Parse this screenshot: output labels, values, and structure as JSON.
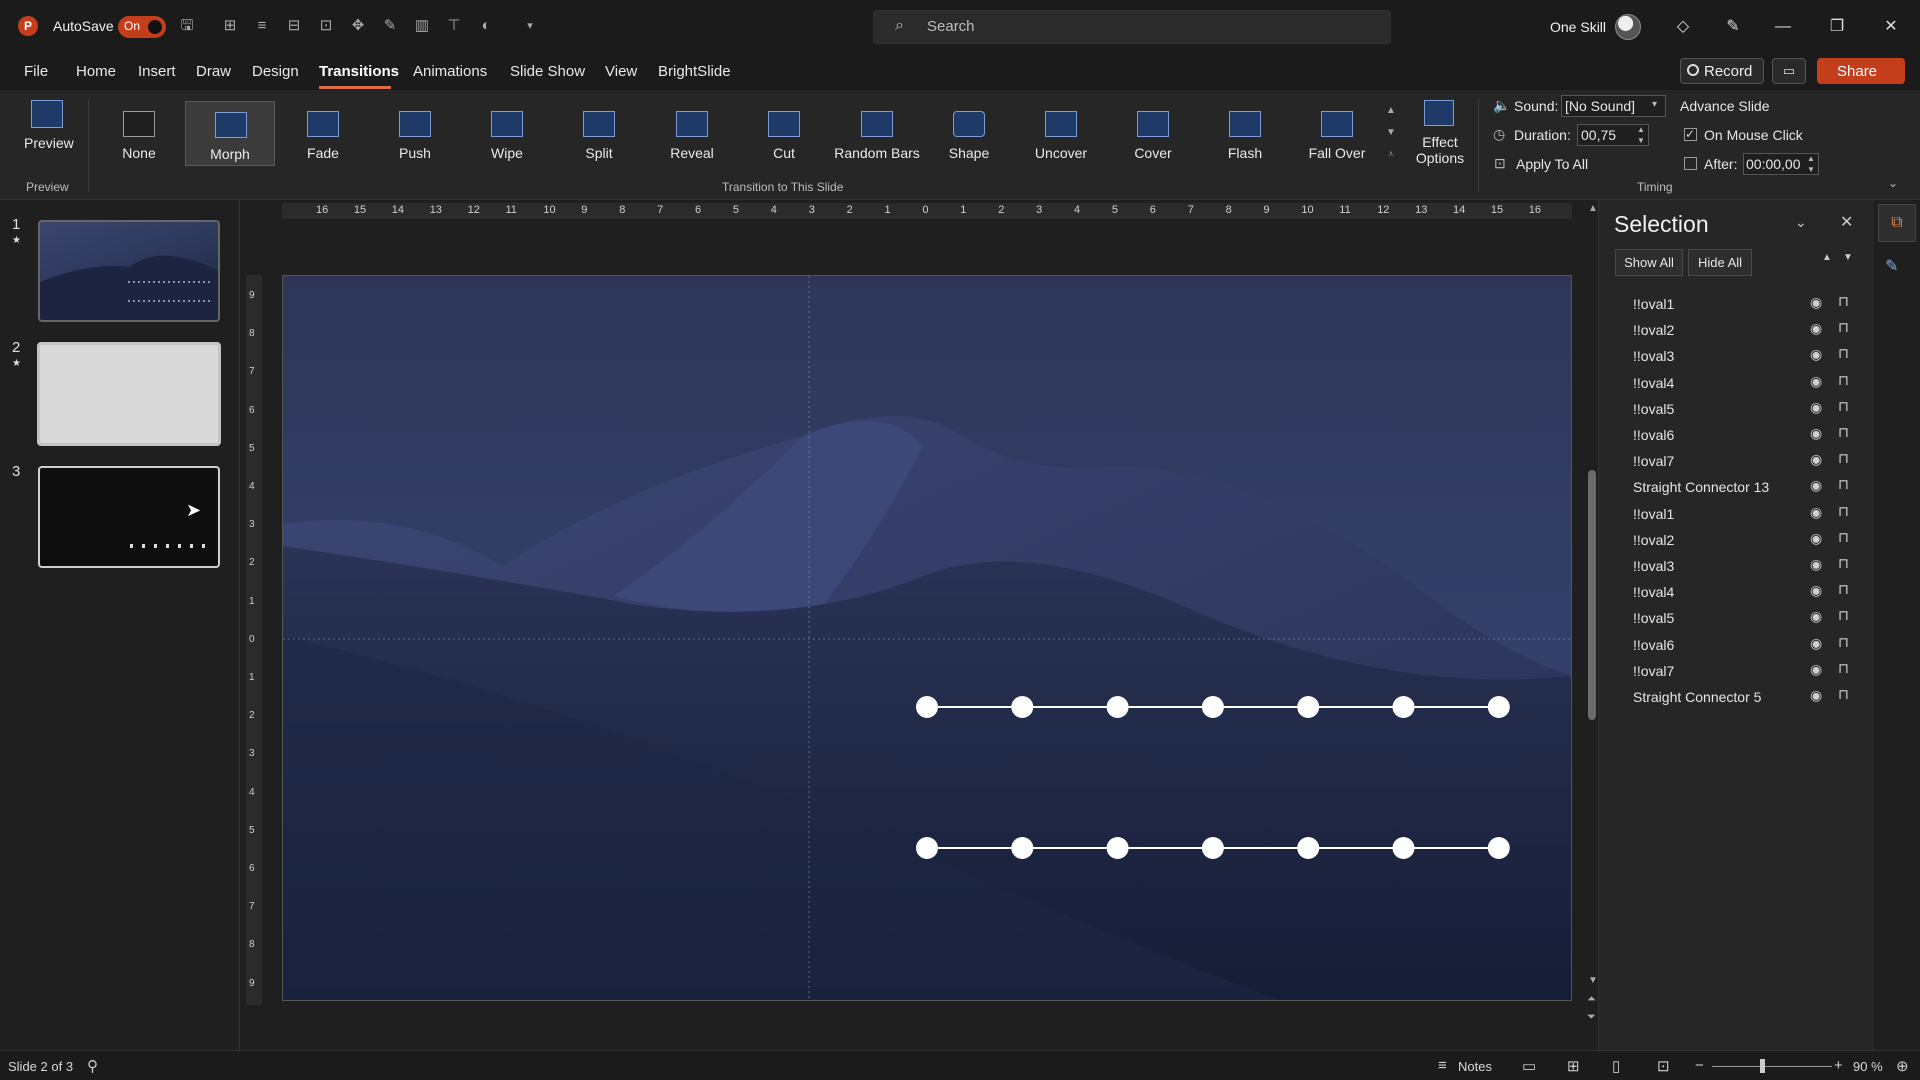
{
  "app": {
    "autosave_label": "AutoSave",
    "autosave_state": "On",
    "search_placeholder": "Search",
    "user_name": "One Skill",
    "brand_color": "#c43e1c"
  },
  "menu": {
    "tabs": [
      "File",
      "Home",
      "Insert",
      "Draw",
      "Design",
      "Transitions",
      "Animations",
      "Slide Show",
      "View",
      "BrightSlide"
    ],
    "active_tab": "Transitions",
    "record_label": "Record",
    "share_label": "Share"
  },
  "ribbon": {
    "preview_label": "Preview",
    "preview_group": "Preview",
    "transitions": [
      "None",
      "Morph",
      "Fade",
      "Push",
      "Wipe",
      "Split",
      "Reveal",
      "Cut",
      "Random Bars",
      "Shape",
      "Uncover",
      "Cover",
      "Flash",
      "Fall Over"
    ],
    "selected_transition": "Morph",
    "transition_group": "Transition to This Slide",
    "effect_options_line1": "Effect",
    "effect_options_line2": "Options",
    "sound_label": "Sound:",
    "sound_value": "[No Sound]",
    "duration_label": "Duration:",
    "duration_value": "00,75",
    "apply_all_label": "Apply To All",
    "advance_label": "Advance Slide",
    "on_mouse_click_label": "On Mouse Click",
    "after_label": "After:",
    "after_value": "00:00,00",
    "timing_group": "Timing"
  },
  "slides": [
    {
      "number": "1",
      "star": "★"
    },
    {
      "number": "2",
      "star": "★"
    },
    {
      "number": "3",
      "star": ""
    }
  ],
  "rulers": {
    "h_ticks": [
      "16",
      "15",
      "14",
      "13",
      "12",
      "11",
      "10",
      "9",
      "8",
      "7",
      "6",
      "5",
      "4",
      "3",
      "2",
      "1",
      "0",
      "1",
      "2",
      "3",
      "4",
      "5",
      "6",
      "7",
      "8",
      "9",
      "10",
      "11",
      "12",
      "13",
      "14",
      "15",
      "16"
    ],
    "v_ticks": [
      "9",
      "8",
      "7",
      "6",
      "5",
      "4",
      "3",
      "2",
      "1",
      "0",
      "1",
      "2",
      "3",
      "4",
      "5",
      "6",
      "7",
      "8",
      "9"
    ]
  },
  "selection_pane": {
    "title": "Selection",
    "show_all": "Show All",
    "hide_all": "Hide All",
    "items": [
      "!!oval1",
      "!!oval2",
      "!!oval3",
      "!!oval4",
      "!!oval5",
      "!!oval6",
      "!!oval7",
      "Straight Connector 13",
      "!!oval1",
      "!!oval2",
      "!!oval3",
      "!!oval4",
      "!!oval5",
      "!!oval6",
      "!!oval7",
      "Straight Connector 5"
    ]
  },
  "status": {
    "slide_info": "Slide 2 of 3",
    "notes_label": "Notes",
    "zoom_value": "90 %"
  }
}
